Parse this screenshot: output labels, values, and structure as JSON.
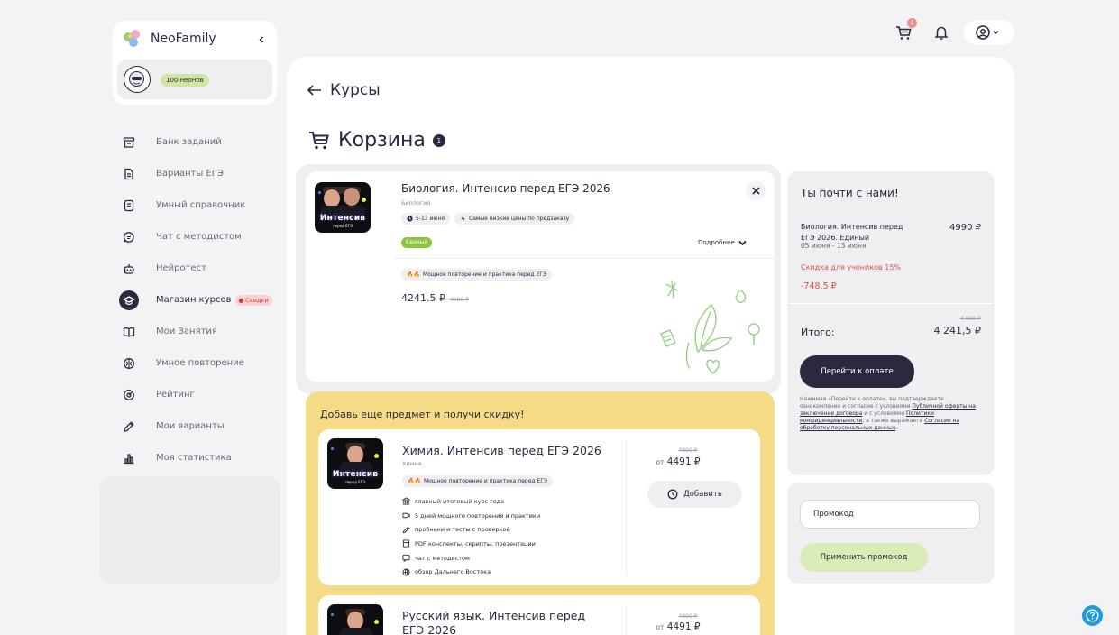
{
  "brand": {
    "name": "NeoFamily"
  },
  "profile": {
    "neons": "100 неонов"
  },
  "sidebar": {
    "items": [
      {
        "label": "Банк заданий",
        "icon": "archive-icon"
      },
      {
        "label": "Варианты ЕГЭ",
        "icon": "document-icon"
      },
      {
        "label": "Умный справочник",
        "icon": "book-icon"
      },
      {
        "label": "Чат с методистом",
        "icon": "chat-icon"
      },
      {
        "label": "Нейротест",
        "icon": "robot-icon"
      },
      {
        "label": "Магазин курсов",
        "icon": "graduation-cap-icon",
        "badge": "Скидки"
      },
      {
        "label": "Мои Занятия",
        "icon": "open-book-icon"
      },
      {
        "label": "Умное повторение",
        "icon": "brain-icon"
      },
      {
        "label": "Рейтинг",
        "icon": "target-icon"
      },
      {
        "label": "Мои варианты",
        "icon": "pencil-icon"
      },
      {
        "label": "Моя статистика",
        "icon": "bar-chart-icon"
      }
    ]
  },
  "topbar": {
    "cart_count": "1"
  },
  "page": {
    "back_label": "Курсы",
    "title": "Корзина",
    "title_count": "1"
  },
  "cart_item": {
    "title": "Биология. Интенсив перед ЕГЭ 2026",
    "subject": "Биология",
    "dates_pill": "5-13 июня",
    "promo_pill": "Самые низкие цены по предзаказу",
    "tariff": "Единый",
    "more_label": "Подробнее",
    "tag": "Мощное повторение и практика перед ЕГЭ",
    "price": "4241.5 ₽",
    "old_price": "4990 ₽",
    "thumb_word": "Интенсив",
    "thumb_sub": "перед ЕГЭ"
  },
  "summary": {
    "title": "Ты почти с нами!",
    "item_name": "Биология. Интенсив перед ЕГЭ 2026. Единый",
    "item_price": "4990 ₽",
    "dates": "05 июня - 13 июня",
    "discount_label": "Скидка для учеников 15%",
    "discount_value": "-748.5 ₽",
    "old_total": "4 990 ₽",
    "total_label": "Итого:",
    "total": "4 241,5 ₽",
    "pay_button": "Перейти к оплате",
    "note_1": "Нажимая «Перейти к оплате», вы подтверждаете ознакомление и согласие с условиями ",
    "note_link_1": "Публичной оферты на заключение договора",
    "note_2": " и с условиями ",
    "note_link_2": "Политики конфиденциальности",
    "note_3": ", а также выражаете ",
    "note_link_3": "Согласие на обработку персональных данных",
    "note_4": "."
  },
  "promo": {
    "placeholder": "Промокод",
    "button": "Применить промокод"
  },
  "upsell": {
    "title": "Добавь еще предмет и получи скидку!",
    "courses": [
      {
        "title": "Химия. Интенсив перед ЕГЭ 2026",
        "subject": "Химия",
        "tag": "Мощное повторение и практика перед ЕГЭ",
        "old_price": "4990 ₽",
        "price_prefix": "от",
        "price": "4491 ₽",
        "add_label": "Добавить",
        "features": [
          "главный итоговый курс года",
          "5 дней мощного повторения и практики",
          "пробники и тесты с проверкой",
          "PDF-конспекты, скрипты, презентации",
          "чат с методистом",
          "обзор Дальнего Востока"
        ]
      },
      {
        "title": "Русский язык. Интенсив перед ЕГЭ 2026",
        "old_price": "4990 ₽",
        "price_prefix": "от",
        "price": "4491 ₽"
      }
    ]
  },
  "colors": {
    "primary": "#2b2840",
    "accent_green": "#8cc63f",
    "sale_red": "#e0504f",
    "upsell_bg": "#f5db86",
    "help": "#1e9be0"
  }
}
